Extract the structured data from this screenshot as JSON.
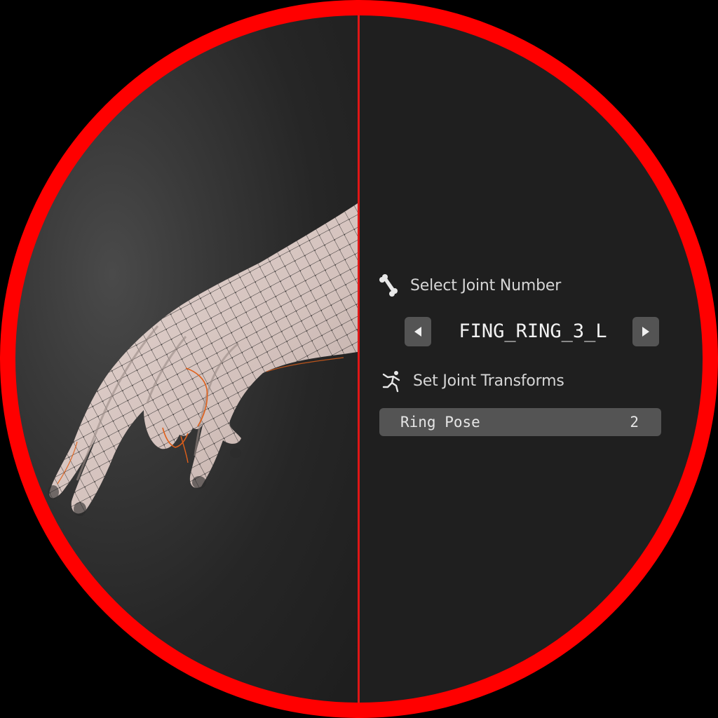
{
  "joint_selector": {
    "title": "Select Joint Number",
    "icon": "bone-icon",
    "current_joint": "FING_RING_3_L",
    "prev_icon": "triangle-left-icon",
    "next_icon": "triangle-right-icon"
  },
  "joint_transforms": {
    "title": "Set Joint Transforms",
    "icon": "pose-figure-icon",
    "fields": [
      {
        "label": "Ring Pose",
        "value": "2"
      }
    ]
  },
  "colors": {
    "frame_ring": "#ff0000",
    "divider": "#e01616",
    "panel_bg": "#1f1f1f",
    "field_bg": "#545454",
    "mesh_skin": "#d9c8c4",
    "selection_edge": "#e0601a"
  }
}
